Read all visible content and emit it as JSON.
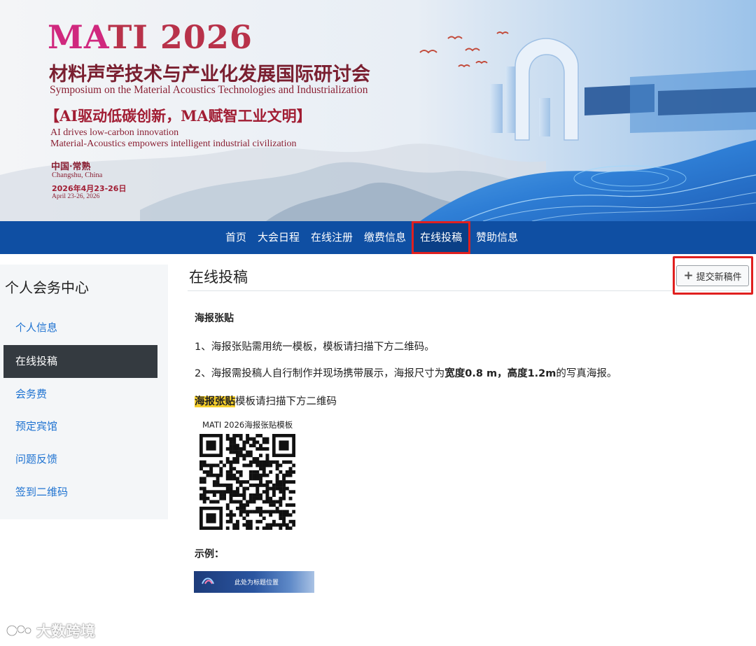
{
  "banner": {
    "title_accent": "MA",
    "title_rest": "TI 2026",
    "title_cn": "材料声学技术与产业化发展国际研讨会",
    "title_en": "Symposium on the Material Acoustics Technologies and Industrialization",
    "slogan_cn": "【AI驱动低碳创新，MA赋智工业文明】",
    "slogan_en_line1": "AI drives low-carbon innovation",
    "slogan_en_line2": "Material-Acoustics empowers intelligent industrial civilization",
    "location_cn": "中国·常熟",
    "location_en": "Changshu, China",
    "date_cn": "2026年4月23-26日",
    "date_en": "April 23-26, 2026"
  },
  "nav": {
    "items": [
      {
        "label": "首页"
      },
      {
        "label": "大会日程"
      },
      {
        "label": "在线注册"
      },
      {
        "label": "缴费信息"
      },
      {
        "label": "在线投稿"
      },
      {
        "label": "赞助信息"
      }
    ],
    "active_index": 4
  },
  "sidebar": {
    "title": "个人会务中心",
    "items": [
      {
        "label": "个人信息"
      },
      {
        "label": "在线投稿"
      },
      {
        "label": "会务费"
      },
      {
        "label": "预定宾馆"
      },
      {
        "label": "问题反馈"
      },
      {
        "label": "签到二维码"
      }
    ],
    "active_index": 1
  },
  "main": {
    "page_title": "在线投稿",
    "submit_button_label": "提交新稿件",
    "section_title": "海报张贴",
    "para1": "1、海报张贴需用统一模板，模板请扫描下方二维码。",
    "para2_prefix": "2、海报需投稿人自行制作并现场携带展示，海报尺寸为",
    "para2_bold1": "宽度0.8 m，高度1.2m",
    "para2_suffix": "的写真海报。",
    "para3_highlight": "海报张贴",
    "para3_rest": "模板请扫描下方二维码",
    "qr_caption": "MATI 2026海报张贴模板",
    "example_label": "示例：",
    "example_image_text": "此处为标题位置"
  },
  "watermark": {
    "text": "大数跨境"
  },
  "colors": {
    "nav_bg": "#0f4fa3",
    "sidebar_active_bg": "#343a40",
    "link": "#1f73d1",
    "highlight": "#f6cf2b",
    "annotation_red": "#e0201f",
    "banner_title": "#b8324a"
  }
}
